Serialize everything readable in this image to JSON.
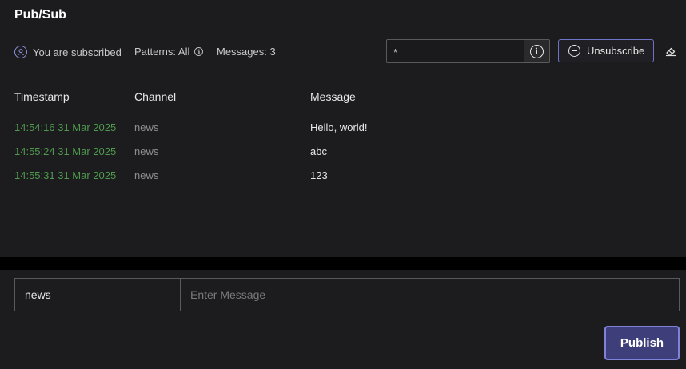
{
  "header": {
    "title": "Pub/Sub"
  },
  "status": {
    "subscribed_text": "You are subscribed",
    "patterns_text": "Patterns: All",
    "messages_text": "Messages: 3"
  },
  "pattern_filter": {
    "value": "*"
  },
  "actions": {
    "unsubscribe_label": "Unsubscribe"
  },
  "table": {
    "columns": [
      "Timestamp",
      "Channel",
      "Message"
    ],
    "rows": [
      {
        "timestamp": "14:54:16 31 Mar 2025",
        "channel": "news",
        "message": "Hello, world!"
      },
      {
        "timestamp": "14:55:24 31 Mar 2025",
        "channel": "news",
        "message": "abc"
      },
      {
        "timestamp": "14:55:31 31 Mar 2025",
        "channel": "news",
        "message": "123"
      }
    ]
  },
  "publish": {
    "channel_value": "news",
    "message_placeholder": "Enter Message",
    "button_label": "Publish"
  },
  "colors": {
    "accent": "#7f82d8",
    "timestamp": "#4f9a4f",
    "background": "#1c1c1e"
  },
  "icons": {
    "subscribed": "user-circle-icon",
    "patterns_info": "info-icon",
    "filter_info": "info-icon",
    "unsubscribe": "minus-circle-icon",
    "clear": "eraser-icon"
  }
}
